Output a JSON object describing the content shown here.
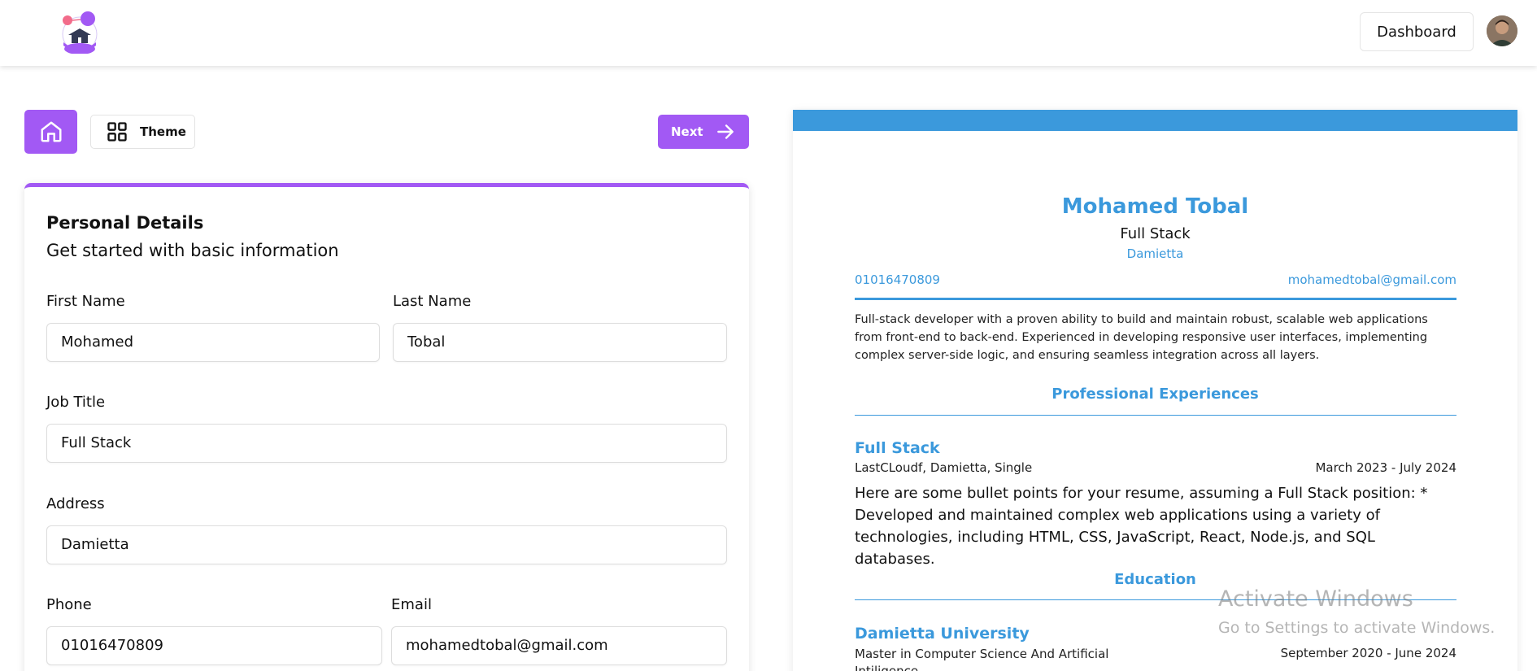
{
  "header": {
    "dashboard_label": "Dashboard"
  },
  "toolbar": {
    "theme_label": "Theme",
    "next_label": "Next"
  },
  "form": {
    "title": "Personal Details",
    "subtitle": "Get started with basic information",
    "first_name": {
      "label": "First Name",
      "value": "Mohamed"
    },
    "last_name": {
      "label": "Last Name",
      "value": "Tobal"
    },
    "job_title": {
      "label": "Job Title",
      "value": "Full Stack"
    },
    "address": {
      "label": "Address",
      "value": "Damietta"
    },
    "phone": {
      "label": "Phone",
      "value": "01016470809"
    },
    "email": {
      "label": "Email",
      "value": "mohamedtobal@gmail.com"
    }
  },
  "resume": {
    "name": "Mohamed Tobal",
    "job_title": "Full Stack",
    "address": "Damietta",
    "phone": "01016470809",
    "email": "mohamedtobal@gmail.com",
    "summary": "Full-stack developer with a proven ability to build and maintain robust, scalable web applications from front-end to back-end. Experienced in developing responsive user interfaces, implementing complex server-side logic, and ensuring seamless integration across all layers.",
    "experience_heading": "Professional Experiences",
    "experience": {
      "title": "Full Stack",
      "company": "LastCLoudf, Damietta, Single",
      "dates": "March 2023 - July 2024",
      "description": "Here are some bullet points for your resume, assuming a Full Stack position: * Developed and maintained complex web applications using a variety of technologies, including HTML, CSS, JavaScript, React, Node.js, and SQL databases."
    },
    "education_heading": "Education",
    "education": {
      "school": "Damietta University",
      "degree": "Master in Computer Science And Artificial Intiligence",
      "dates": "September 2020 - June 2024"
    },
    "accent_color": "#3b99dc"
  },
  "brand_color": "#a259f4",
  "watermark": {
    "title": "Activate Windows",
    "subtitle": "Go to Settings to activate Windows."
  },
  "icons": {
    "logo": "logo-icon",
    "home": "home-icon",
    "theme": "grid-icon",
    "next": "arrow-right-icon"
  }
}
